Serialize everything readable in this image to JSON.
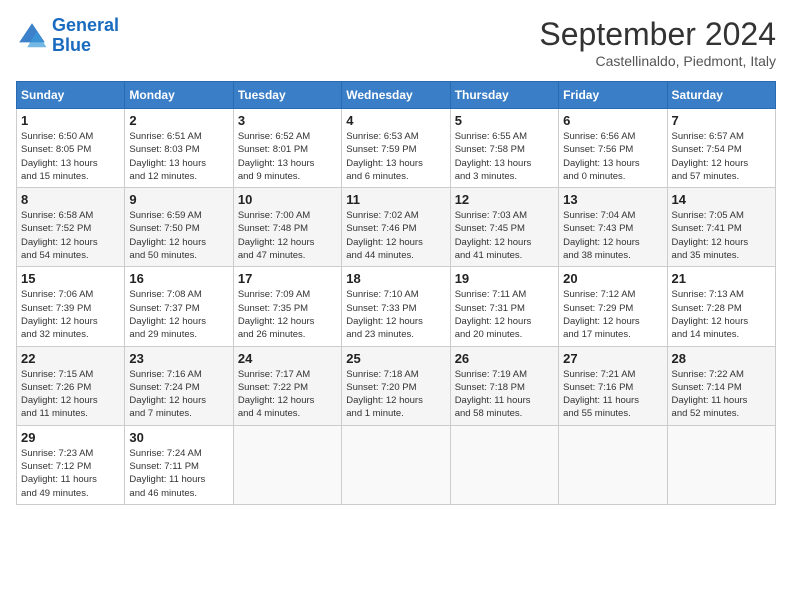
{
  "logo": {
    "line1": "General",
    "line2": "Blue"
  },
  "title": "September 2024",
  "subtitle": "Castellinaldo, Piedmont, Italy",
  "days_of_week": [
    "Sunday",
    "Monday",
    "Tuesday",
    "Wednesday",
    "Thursday",
    "Friday",
    "Saturday"
  ],
  "weeks": [
    [
      {
        "day": 1,
        "info": "Sunrise: 6:50 AM\nSunset: 8:05 PM\nDaylight: 13 hours\nand 15 minutes."
      },
      {
        "day": 2,
        "info": "Sunrise: 6:51 AM\nSunset: 8:03 PM\nDaylight: 13 hours\nand 12 minutes."
      },
      {
        "day": 3,
        "info": "Sunrise: 6:52 AM\nSunset: 8:01 PM\nDaylight: 13 hours\nand 9 minutes."
      },
      {
        "day": 4,
        "info": "Sunrise: 6:53 AM\nSunset: 7:59 PM\nDaylight: 13 hours\nand 6 minutes."
      },
      {
        "day": 5,
        "info": "Sunrise: 6:55 AM\nSunset: 7:58 PM\nDaylight: 13 hours\nand 3 minutes."
      },
      {
        "day": 6,
        "info": "Sunrise: 6:56 AM\nSunset: 7:56 PM\nDaylight: 13 hours\nand 0 minutes."
      },
      {
        "day": 7,
        "info": "Sunrise: 6:57 AM\nSunset: 7:54 PM\nDaylight: 12 hours\nand 57 minutes."
      }
    ],
    [
      {
        "day": 8,
        "info": "Sunrise: 6:58 AM\nSunset: 7:52 PM\nDaylight: 12 hours\nand 54 minutes."
      },
      {
        "day": 9,
        "info": "Sunrise: 6:59 AM\nSunset: 7:50 PM\nDaylight: 12 hours\nand 50 minutes."
      },
      {
        "day": 10,
        "info": "Sunrise: 7:00 AM\nSunset: 7:48 PM\nDaylight: 12 hours\nand 47 minutes."
      },
      {
        "day": 11,
        "info": "Sunrise: 7:02 AM\nSunset: 7:46 PM\nDaylight: 12 hours\nand 44 minutes."
      },
      {
        "day": 12,
        "info": "Sunrise: 7:03 AM\nSunset: 7:45 PM\nDaylight: 12 hours\nand 41 minutes."
      },
      {
        "day": 13,
        "info": "Sunrise: 7:04 AM\nSunset: 7:43 PM\nDaylight: 12 hours\nand 38 minutes."
      },
      {
        "day": 14,
        "info": "Sunrise: 7:05 AM\nSunset: 7:41 PM\nDaylight: 12 hours\nand 35 minutes."
      }
    ],
    [
      {
        "day": 15,
        "info": "Sunrise: 7:06 AM\nSunset: 7:39 PM\nDaylight: 12 hours\nand 32 minutes."
      },
      {
        "day": 16,
        "info": "Sunrise: 7:08 AM\nSunset: 7:37 PM\nDaylight: 12 hours\nand 29 minutes."
      },
      {
        "day": 17,
        "info": "Sunrise: 7:09 AM\nSunset: 7:35 PM\nDaylight: 12 hours\nand 26 minutes."
      },
      {
        "day": 18,
        "info": "Sunrise: 7:10 AM\nSunset: 7:33 PM\nDaylight: 12 hours\nand 23 minutes."
      },
      {
        "day": 19,
        "info": "Sunrise: 7:11 AM\nSunset: 7:31 PM\nDaylight: 12 hours\nand 20 minutes."
      },
      {
        "day": 20,
        "info": "Sunrise: 7:12 AM\nSunset: 7:29 PM\nDaylight: 12 hours\nand 17 minutes."
      },
      {
        "day": 21,
        "info": "Sunrise: 7:13 AM\nSunset: 7:28 PM\nDaylight: 12 hours\nand 14 minutes."
      }
    ],
    [
      {
        "day": 22,
        "info": "Sunrise: 7:15 AM\nSunset: 7:26 PM\nDaylight: 12 hours\nand 11 minutes."
      },
      {
        "day": 23,
        "info": "Sunrise: 7:16 AM\nSunset: 7:24 PM\nDaylight: 12 hours\nand 7 minutes."
      },
      {
        "day": 24,
        "info": "Sunrise: 7:17 AM\nSunset: 7:22 PM\nDaylight: 12 hours\nand 4 minutes."
      },
      {
        "day": 25,
        "info": "Sunrise: 7:18 AM\nSunset: 7:20 PM\nDaylight: 12 hours\nand 1 minute."
      },
      {
        "day": 26,
        "info": "Sunrise: 7:19 AM\nSunset: 7:18 PM\nDaylight: 11 hours\nand 58 minutes."
      },
      {
        "day": 27,
        "info": "Sunrise: 7:21 AM\nSunset: 7:16 PM\nDaylight: 11 hours\nand 55 minutes."
      },
      {
        "day": 28,
        "info": "Sunrise: 7:22 AM\nSunset: 7:14 PM\nDaylight: 11 hours\nand 52 minutes."
      }
    ],
    [
      {
        "day": 29,
        "info": "Sunrise: 7:23 AM\nSunset: 7:12 PM\nDaylight: 11 hours\nand 49 minutes."
      },
      {
        "day": 30,
        "info": "Sunrise: 7:24 AM\nSunset: 7:11 PM\nDaylight: 11 hours\nand 46 minutes."
      },
      null,
      null,
      null,
      null,
      null
    ]
  ]
}
